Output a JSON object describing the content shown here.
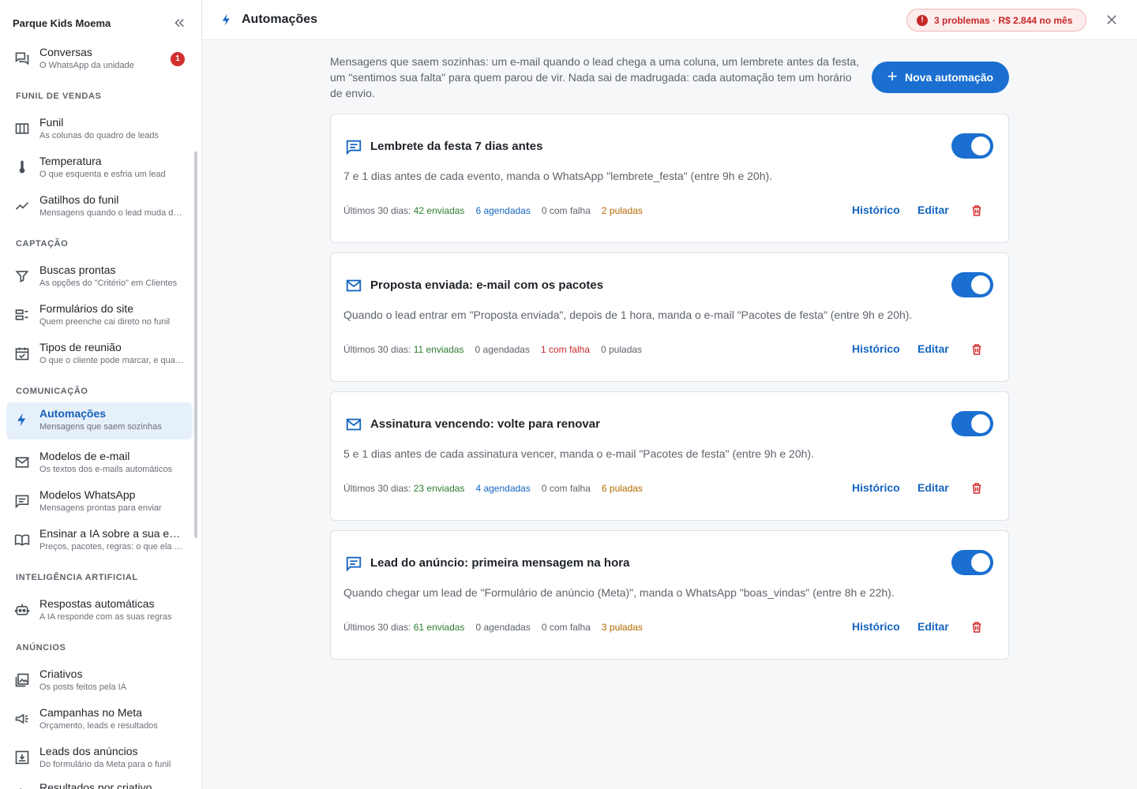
{
  "sidebar": {
    "title": "Parque Kids Moema",
    "conversas": {
      "label": "Conversas",
      "sub": "O WhatsApp da unidade",
      "badge": "1"
    },
    "sections": {
      "funil": "FUNIL DE VENDAS",
      "captacao": "CAPTAÇÃO",
      "comunicacao": "COMUNICAÇÃO",
      "ia": "INTELIGÊNCIA ARTIFICIAL",
      "anuncios": "ANÚNCIOS"
    },
    "items": {
      "funil": {
        "label": "Funil",
        "sub": "As colunas do quadro de leads"
      },
      "temperatura": {
        "label": "Temperatura",
        "sub": "O que esquenta e esfria um lead"
      },
      "gatilhos": {
        "label": "Gatilhos do funil",
        "sub": "Mensagens quando o lead muda de coluna"
      },
      "buscas": {
        "label": "Buscas prontas",
        "sub": "As opções do \"Critério\" em Clientes"
      },
      "formularios": {
        "label": "Formulários do site",
        "sub": "Quem preenche cai direto no funil"
      },
      "reuniao": {
        "label": "Tipos de reunião",
        "sub": "O que o cliente pode marcar, e quando"
      },
      "automacoes": {
        "label": "Automações",
        "sub": "Mensagens que saem sozinhas"
      },
      "email": {
        "label": "Modelos de e-mail",
        "sub": "Os textos dos e-mails automáticos"
      },
      "whatsapp": {
        "label": "Modelos WhatsApp",
        "sub": "Mensagens prontas para enviar"
      },
      "ensinar": {
        "label": "Ensinar a IA sobre a sua empresa",
        "sub": "Preços, pacotes, regras: o que ela precisa saber"
      },
      "respostas": {
        "label": "Respostas automáticas",
        "sub": "A IA responde com as suas regras"
      },
      "criativos": {
        "label": "Criativos",
        "sub": "Os posts feitos pela IA"
      },
      "campanhas": {
        "label": "Campanhas no Meta",
        "sub": "Orçamento, leads e resultados"
      },
      "leads": {
        "label": "Leads dos anúncios",
        "sub": "Do formulário da Meta para o funil"
      },
      "resultados": {
        "label": "Resultados por criativo",
        "sub": ""
      }
    }
  },
  "header": {
    "title": "Automações",
    "problems": "3 problemas · R$ 2.844 no mês",
    "problems_icon": "!"
  },
  "main": {
    "intro": "Mensagens que saem sozinhas: um e-mail quando o lead chega a uma coluna, um lembrete antes da festa, um \"sentimos sua falta\" para quem parou de vir. Nada sai de madrugada: cada automação tem um horário de envio.",
    "new_button": "Nova automação",
    "new_button_icon": "+",
    "stats_prefix": "Últimos 30 dias:",
    "history_label": "Histórico",
    "edit_label": "Editar",
    "cards": [
      {
        "icon": "chat-icon",
        "title": "Lembrete da festa 7 dias antes",
        "desc": "7 e 1 dias antes de cada evento, manda o WhatsApp \"lembrete_festa\" (entre 9h e 20h).",
        "enabled": true,
        "sent": "42 enviadas",
        "scheduled": "6 agendadas",
        "failed": "0 com falha",
        "skipped": "2 puladas"
      },
      {
        "icon": "mail-icon",
        "title": "Proposta enviada: e-mail com os pacotes",
        "desc": "Quando o lead entrar em \"Proposta enviada\", depois de 1 hora, manda o e-mail \"Pacotes de festa\" (entre 9h e 20h).",
        "enabled": true,
        "sent": "11 enviadas",
        "scheduled": "0 agendadas",
        "failed": "1 com falha",
        "skipped": "0 puladas"
      },
      {
        "icon": "mail-icon",
        "title": "Assinatura vencendo: volte para renovar",
        "desc": "5 e 1 dias antes de cada assinatura vencer, manda o e-mail \"Pacotes de festa\" (entre 9h e 20h).",
        "enabled": true,
        "sent": "23 enviadas",
        "scheduled": "4 agendadas",
        "failed": "0 com falha",
        "skipped": "6 puladas"
      },
      {
        "icon": "chat-icon",
        "title": "Lead do anúncio: primeira mensagem na hora",
        "desc": "Quando chegar um lead de \"Formulário de anúncio (Meta)\", manda o WhatsApp \"boas_vindas\" (entre 8h e 22h).",
        "enabled": true,
        "sent": "61 enviadas",
        "scheduled": "0 agendadas",
        "failed": "0 com falha",
        "skipped": "3 puladas"
      }
    ]
  },
  "colors": {
    "accent": "#1a6fd1",
    "danger": "#d32f2f",
    "success": "#2e7d32",
    "warning": "#b26a00"
  }
}
